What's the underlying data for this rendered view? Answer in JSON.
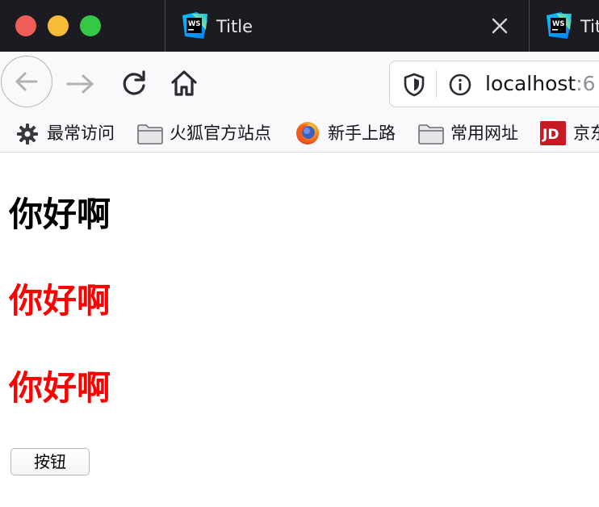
{
  "window": {
    "traffic_lights": [
      "close",
      "minimize",
      "zoom"
    ]
  },
  "tabs": [
    {
      "title": "Title",
      "icon": "webstorm-icon",
      "active": true,
      "closable": true
    },
    {
      "title": "Title",
      "icon": "webstorm-icon",
      "active": false
    }
  ],
  "toolbar": {
    "back_icon": "arrow-left-icon",
    "forward_icon": "arrow-right-icon",
    "reload_icon": "reload-icon",
    "home_icon": "home-icon"
  },
  "urlbar": {
    "host": "localhost",
    "port_fragment": ":6",
    "shield_icon": "shield-icon",
    "info_icon": "info-icon"
  },
  "bookmarks": [
    {
      "label": "最常访问",
      "icon": "gear-icon"
    },
    {
      "label": "火狐官方站点",
      "icon": "folder-icon"
    },
    {
      "label": "新手上路",
      "icon": "firefox-icon"
    },
    {
      "label": "常用网址",
      "icon": "folder-icon"
    },
    {
      "label": "京东",
      "icon": "jd-icon"
    }
  ],
  "page": {
    "headings": [
      {
        "text": "你好啊",
        "color": "#000000"
      },
      {
        "text": "你好啊",
        "color": "#ff0000"
      },
      {
        "text": "你好啊",
        "color": "#ff0000"
      }
    ],
    "button_label": "按钮"
  },
  "colors": {
    "titlebar_bg": "#1c1b22",
    "toolbar_bg": "#f9f9fb",
    "traffic_red": "#f05d59",
    "traffic_yellow": "#f8bd38",
    "traffic_green": "#37c848",
    "heading_red": "#ff0000"
  }
}
